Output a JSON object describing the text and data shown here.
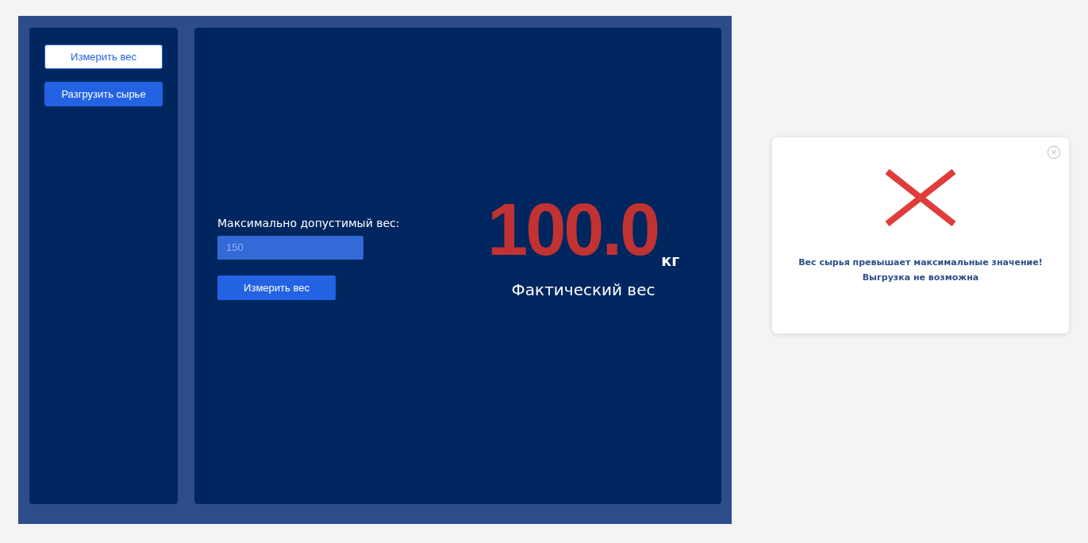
{
  "sidebar": {
    "buttons": [
      {
        "label": "Измерить вес",
        "selected": true
      },
      {
        "label": "Разгрузить сырье",
        "selected": false
      }
    ]
  },
  "form": {
    "label": "Максимально допустимый вес:",
    "placeholder": "150",
    "button": "Измерить вес"
  },
  "reading": {
    "value": "100.0",
    "unit": "кг",
    "caption": "Фактический вес"
  },
  "alert": {
    "message_lines": [
      "Вес сырья превышает максимальные значение!",
      "Выгрузка не возможна"
    ]
  }
}
